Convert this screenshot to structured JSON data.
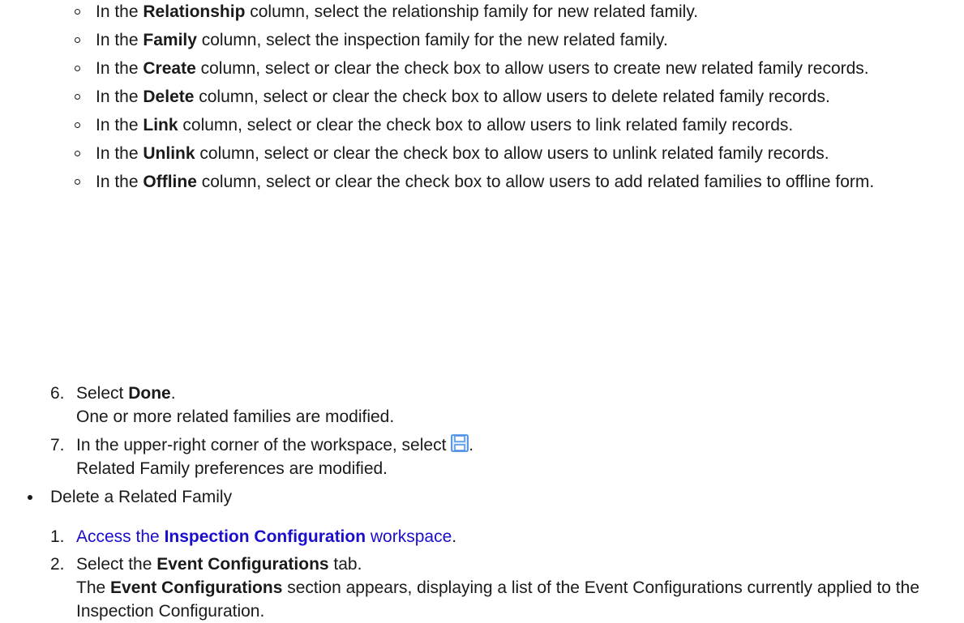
{
  "sub_steps": [
    {
      "pre": "In the ",
      "bold": "Relationship",
      "post": " column, select the relationship family for new related family."
    },
    {
      "pre": "In the ",
      "bold": "Family",
      "post": " column, select the inspection family for the new related family."
    },
    {
      "pre": "In the ",
      "bold": "Create",
      "post": " column, select or clear the check box to allow users to create new related family records."
    },
    {
      "pre": "In the ",
      "bold": "Delete",
      "post": " column, select or clear the check box to allow users to delete related family records."
    },
    {
      "pre": "In the ",
      "bold": "Link",
      "post": " column, select or clear the check box to allow users to link related family records."
    },
    {
      "pre": "In the ",
      "bold": "Unlink",
      "post": " column, select or clear the check box to allow users to unlink related family records."
    },
    {
      "pre": "In the ",
      "bold": "Offline",
      "post": " column, select or clear the check box to allow users to add related families to offline form."
    }
  ],
  "step6": {
    "num": "6.",
    "pre": "Select ",
    "bold": "Done",
    "post": ".",
    "result": "One or more related families are modified."
  },
  "step7": {
    "num": "7.",
    "pre": "In the upper-right corner of the workspace, select ",
    "icon": "save-icon",
    "post": ".",
    "result": "Related Family preferences are modified."
  },
  "delete_section": {
    "title": "Delete a Related Family",
    "step1": {
      "num": "1.",
      "link_pre": "Access the ",
      "link_bold": "Inspection Configuration",
      "link_post": " workspace",
      "post": "."
    },
    "step2": {
      "num": "2.",
      "pre": "Select the ",
      "bold": "Event Configurations",
      "post": " tab.",
      "result_pre": "The ",
      "result_bold": "Event Configurations",
      "result_post": " section appears, displaying a list of the Event Configurations currently applied to the Inspection Configuration."
    }
  },
  "colors": {
    "text": "#1a1a1a",
    "link": "#1a0dcc",
    "icon": "#4a90e2"
  }
}
